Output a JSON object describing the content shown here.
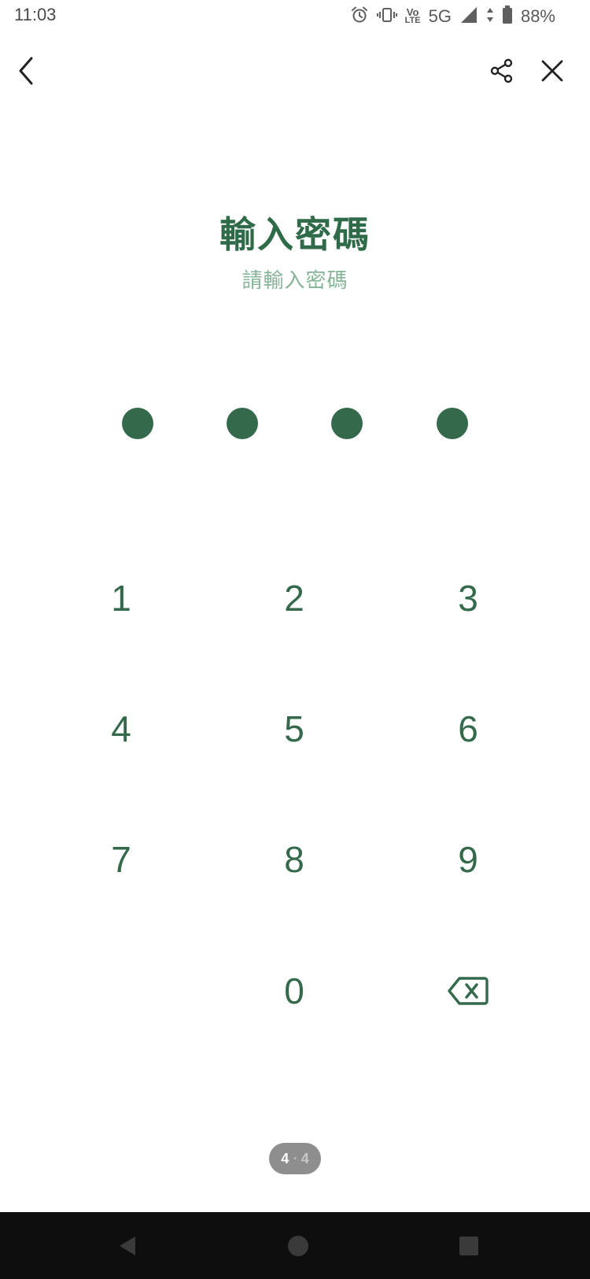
{
  "status_bar": {
    "time": "11:03",
    "network": "5G",
    "volte_top": "Vo",
    "volte_bottom": "LTE",
    "battery": "88%",
    "icons": [
      "alarm-icon",
      "vibrate-icon",
      "volte-icon",
      "signal-icon",
      "data-arrows-icon",
      "battery-icon"
    ]
  },
  "header": {
    "back_icon": "chevron-left-icon",
    "share_icon": "share-icon",
    "close_icon": "close-icon"
  },
  "main": {
    "title": "輸入密碼",
    "subtitle": "請輸入密碼",
    "pin_length": 4,
    "pin_filled": 4
  },
  "keypad": {
    "keys": [
      "1",
      "2",
      "3",
      "4",
      "5",
      "6",
      "7",
      "8",
      "9",
      "",
      "0"
    ],
    "backspace_icon": "backspace-icon"
  },
  "page_indicator": {
    "current": "4",
    "separator": "•",
    "total": "4"
  },
  "nav_bar": {
    "icons": [
      "nav-back-icon",
      "nav-home-icon",
      "nav-recent-icon"
    ]
  },
  "colors": {
    "primary": "#346a4b",
    "title": "#2f6b49",
    "subtitle": "#86b497",
    "nav_background": "#0e0e0e"
  }
}
